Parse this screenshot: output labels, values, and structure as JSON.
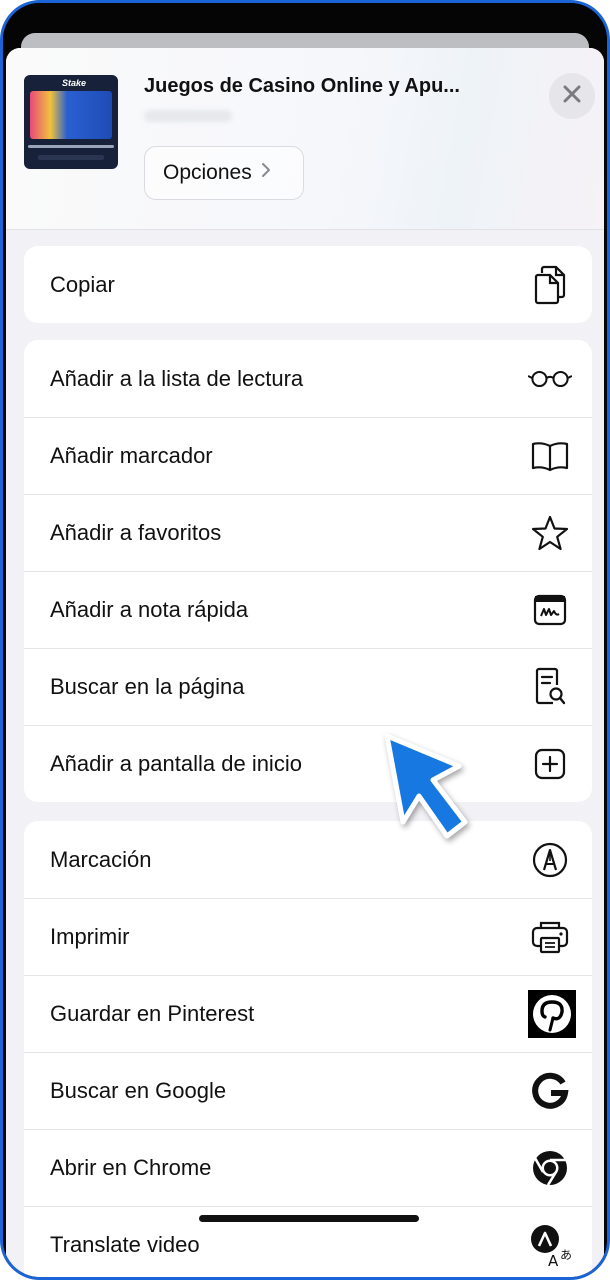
{
  "header": {
    "page_title": "Juegos de Casino Online y Apu...",
    "options_label": "Opciones",
    "thumbnail_logo": "Stake"
  },
  "groups": [
    {
      "rows": [
        {
          "label": "Copiar",
          "icon": "copy-icon"
        }
      ]
    },
    {
      "rows": [
        {
          "label": "Añadir a la lista de lectura",
          "icon": "glasses-icon"
        },
        {
          "label": "Añadir marcador",
          "icon": "book-icon"
        },
        {
          "label": "Añadir a favoritos",
          "icon": "star-icon"
        },
        {
          "label": "Añadir a nota rápida",
          "icon": "quick-note-icon"
        },
        {
          "label": "Buscar en la página",
          "icon": "find-in-page-icon"
        },
        {
          "label": "Añadir a pantalla de inicio",
          "icon": "add-square-icon"
        }
      ]
    },
    {
      "rows": [
        {
          "label": "Marcación",
          "icon": "markup-pen-icon"
        },
        {
          "label": "Imprimir",
          "icon": "printer-icon"
        },
        {
          "label": "Guardar en Pinterest",
          "icon": "pinterest-icon"
        },
        {
          "label": "Buscar en Google",
          "icon": "google-icon"
        },
        {
          "label": "Abrir en Chrome",
          "icon": "chrome-icon"
        },
        {
          "label": "Translate video",
          "icon": "translate-icon"
        }
      ]
    }
  ],
  "colors": {
    "frame_border": "#1a64d6",
    "cursor_fill": "#1478e0",
    "sheet_background": "#f2f2f6"
  }
}
